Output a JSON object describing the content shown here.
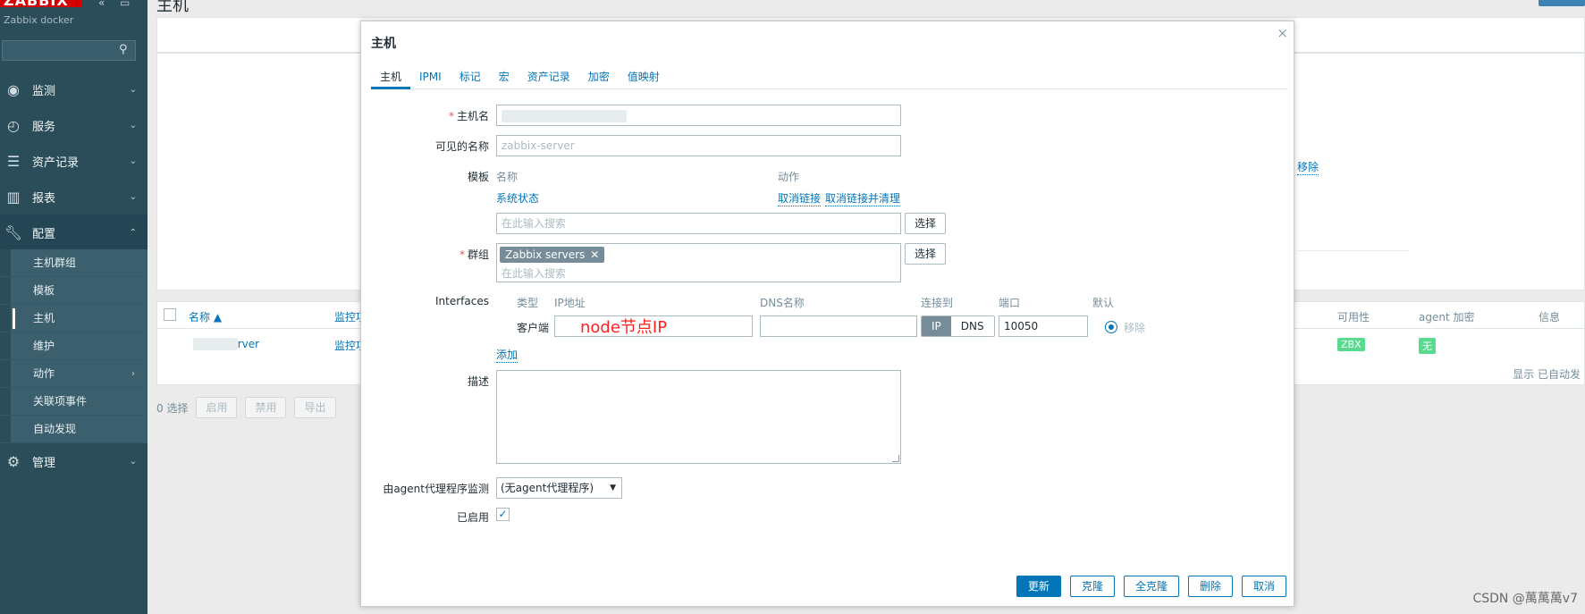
{
  "sidebar": {
    "logo": "ZABBIX",
    "server": "Zabbix docker",
    "menu": [
      {
        "label": "监测",
        "icon": "eye-icon"
      },
      {
        "label": "服务",
        "icon": "clock-icon"
      },
      {
        "label": "资产记录",
        "icon": "list-icon"
      },
      {
        "label": "报表",
        "icon": "bar-chart-icon"
      },
      {
        "label": "配置",
        "icon": "wrench-icon"
      },
      {
        "label": "管理",
        "icon": "gear-icon"
      }
    ],
    "submenu": [
      "主机群组",
      "模板",
      "主机",
      "维护",
      "动作",
      "关联项事件",
      "自动发现"
    ]
  },
  "background": {
    "title": "主机",
    "remove": "移除",
    "columns": {
      "name": "名称 ▲",
      "items": "监控项",
      "availability": "可用性",
      "encryption": "agent 加密",
      "info": "信息"
    },
    "row": {
      "name_suffix": "rver",
      "items": "监控项",
      "availability": "ZBX",
      "encryption": "无"
    },
    "footer": "显示 已自动发",
    "selected": "0 选择",
    "actions": {
      "enable": "启用",
      "disable": "禁用",
      "export": "导出"
    }
  },
  "modal": {
    "title": "主机",
    "close": "×",
    "tabs": [
      "主机",
      "IPMI",
      "标记",
      "宏",
      "资产记录",
      "加密",
      "值映射"
    ],
    "fields": {
      "hostname_label": "主机名",
      "visible_name_label": "可见的名称",
      "visible_name_placeholder": "zabbix-server",
      "templates_label": "模板",
      "templates_col_name": "名称",
      "templates_col_action": "动作",
      "template_name": "系统状态",
      "unlink": "取消链接",
      "unlink_clear": "取消链接并清理",
      "search_placeholder": "在此输入搜索",
      "select": "选择",
      "groups_label": "群组",
      "group_chip": "Zabbix servers",
      "interfaces_label": "Interfaces",
      "iface_headers": {
        "type": "类型",
        "ip": "IP地址",
        "dns": "DNS名称",
        "connect": "连接到",
        "port": "端口",
        "default": "默认"
      },
      "iface_type": "客户端",
      "annotation": "node节点IP",
      "connect_ip": "IP",
      "connect_dns": "DNS",
      "port": "10050",
      "iface_remove": "移除",
      "add": "添加",
      "description_label": "描述",
      "proxy_label": "由agent代理程序监测",
      "proxy_value": "(无agent代理程序)",
      "enabled_label": "已启用"
    },
    "buttons": {
      "update": "更新",
      "clone": "克隆",
      "full_clone": "全克隆",
      "delete": "删除",
      "cancel": "取消"
    }
  },
  "watermark": "CSDN @萬萬萬v7",
  "colors": {
    "sidebar": "#2b4c59",
    "link": "#0275b8",
    "required": "#e45959",
    "annotation": "#ff2020",
    "badge_green": "#59db8f"
  }
}
